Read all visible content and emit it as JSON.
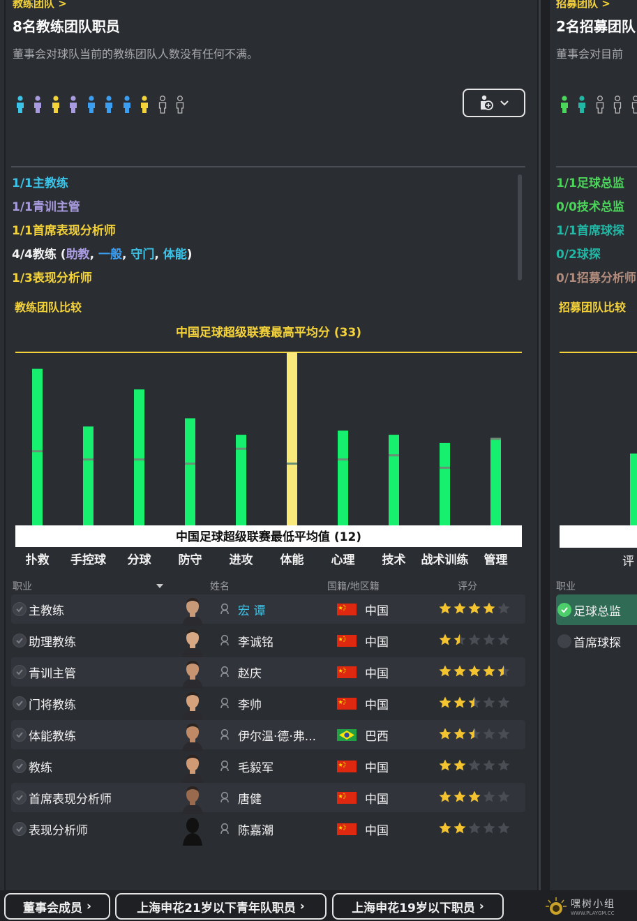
{
  "left_panel": {
    "breadcrumb": "教练团队 >",
    "title": "8名教练团队职员",
    "subtitle": "董事会对球队当前的教练团队人数没有任何不满。",
    "people_icons": [
      "cyan",
      "purple",
      "yellow",
      "purple",
      "blue",
      "blue",
      "blue",
      "yellow",
      "empty",
      "empty"
    ],
    "roles_summary": [
      {
        "count": "1/1",
        "label": "主教练",
        "color": "#3cc3e8"
      },
      {
        "count": "1/1",
        "label": "青训主管",
        "color": "#a99be0"
      },
      {
        "count": "1/1",
        "label": "首席表现分析师",
        "color": "#f4d23a"
      },
      {
        "count": "1/3",
        "label": "表现分析师",
        "color": "#f4d23a"
      }
    ],
    "coaches_line": {
      "prefix": "4/4教练 (",
      "parts": [
        {
          "text": "助教",
          "color": "#a99be0"
        },
        {
          "text": "一般",
          "color": "#3c9ef0"
        },
        {
          "text": "守门",
          "color": "#3cc3e8"
        },
        {
          "text": "体能",
          "color": "#3cc3e8"
        }
      ],
      "suffix": ")"
    },
    "comparison_title": "教练团队比较",
    "chart_data": {
      "type": "bar",
      "title": "",
      "top_label": "中国足球超级联赛最高平均分 (33)",
      "bottom_label": "中国足球超级联赛最低平均值 (12)",
      "ylim": [
        12,
        33
      ],
      "categories": [
        "扑救",
        "手控球",
        "分球",
        "防守",
        "进攻",
        "体能",
        "心理",
        "技术",
        "战术训练",
        "管理"
      ],
      "values": [
        31,
        24,
        28.5,
        25,
        23,
        33,
        23.5,
        23,
        22,
        22.5
      ],
      "averages": [
        21,
        20,
        20,
        19.5,
        21.3,
        19.5,
        20,
        20.5,
        19,
        22.5
      ],
      "highlight_index": 5,
      "colors": {
        "bar": "#16f06e",
        "highlight": "#f8e97a",
        "avg_tick": "#6a8f74",
        "max_line": "#f4d23a"
      }
    },
    "table": {
      "headers": {
        "role": "职业",
        "name": "姓名",
        "nation": "国籍/地区籍",
        "rating": "评分"
      },
      "rows": [
        {
          "role": "主教练",
          "name": "宏 谭",
          "nation": "中国",
          "flag": "china",
          "stars": 4,
          "highlight": true
        },
        {
          "role": "助理教练",
          "name": "李诚铭",
          "nation": "中国",
          "flag": "china",
          "stars": 1.5
        },
        {
          "role": "青训主管",
          "name": "赵庆",
          "nation": "中国",
          "flag": "china",
          "stars": 4.5
        },
        {
          "role": "门将教练",
          "name": "李帅",
          "nation": "中国",
          "flag": "china",
          "stars": 2.5
        },
        {
          "role": "体能教练",
          "name": "伊尔温·德·弗...",
          "nation": "巴西",
          "flag": "brazil",
          "stars": 2.5
        },
        {
          "role": "教练",
          "name": "毛毅军",
          "nation": "中国",
          "flag": "china",
          "stars": 2
        },
        {
          "role": "首席表现分析师",
          "name": "唐健",
          "nation": "中国",
          "flag": "china",
          "stars": 3
        },
        {
          "role": "表现分析师",
          "name": "陈嘉潮",
          "nation": "中国",
          "flag": "china",
          "stars": 2
        }
      ]
    }
  },
  "right_panel": {
    "breadcrumb": "招募团队 >",
    "title": "2名招募团队",
    "subtitle": "董事会对目前",
    "roles_summary": [
      {
        "count": "1/1",
        "label": "足球总监",
        "color": "#4cd55b"
      },
      {
        "count": "0/0",
        "label": "技术总监",
        "color": "#4cd55b"
      },
      {
        "count": "1/1",
        "label": "首席球探",
        "color": "#22b6a5"
      },
      {
        "count": "0/2",
        "label": "球探",
        "color": "#22b6a5"
      },
      {
        "count": "0/1",
        "label": "招募分析师",
        "color": "#b08a7a"
      }
    ],
    "comparison_title": "招募团队比较",
    "axis_label": "评",
    "table_header": "职业",
    "rows": [
      {
        "role": "足球总监",
        "selected": true
      },
      {
        "role": "首席球探",
        "selected": false
      }
    ]
  },
  "bottom_buttons": [
    "董事会成员",
    "上海申花21岁以下青年队职员",
    "上海申花19岁以下职员"
  ],
  "watermark": {
    "text": "嘿树小组",
    "url": "WWW.PLAYGM.CC"
  }
}
